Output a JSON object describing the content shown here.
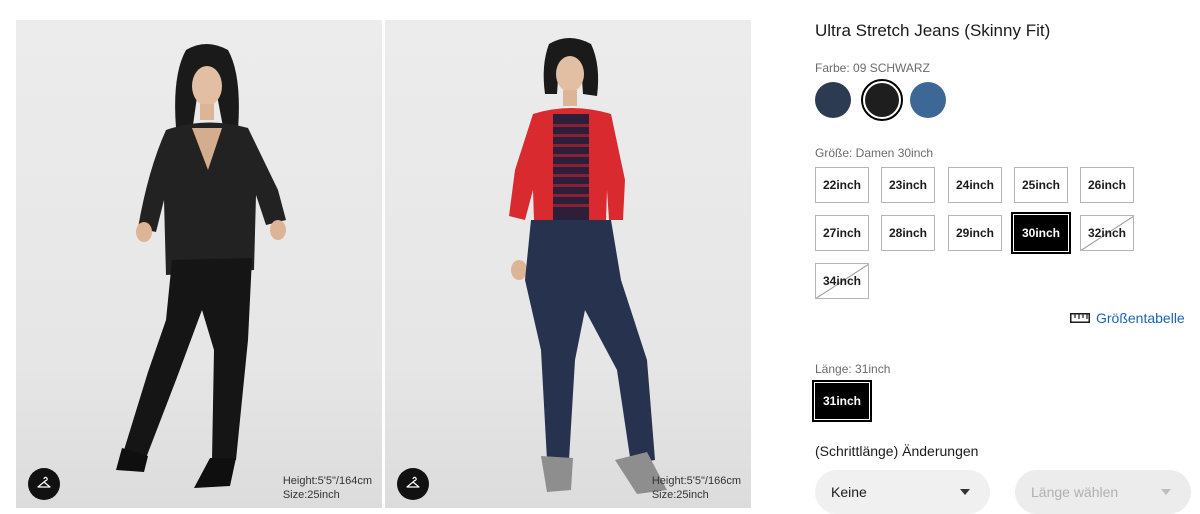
{
  "product": {
    "title": "Ultra Stretch Jeans (Skinny Fit)"
  },
  "color": {
    "label": "Farbe: 09 SCHWARZ",
    "swatches": [
      {
        "name": "navy",
        "hex": "#2c3a52",
        "selected": false
      },
      {
        "name": "black",
        "hex": "#1e1e1e",
        "selected": true
      },
      {
        "name": "blue",
        "hex": "#3d6796",
        "selected": false
      }
    ]
  },
  "size": {
    "label": "Größe: Damen 30inch",
    "options": [
      {
        "label": "22inch",
        "state": "available"
      },
      {
        "label": "23inch",
        "state": "available"
      },
      {
        "label": "24inch",
        "state": "available"
      },
      {
        "label": "25inch",
        "state": "available"
      },
      {
        "label": "26inch",
        "state": "available"
      },
      {
        "label": "27inch",
        "state": "available"
      },
      {
        "label": "28inch",
        "state": "available"
      },
      {
        "label": "29inch",
        "state": "available"
      },
      {
        "label": "30inch",
        "state": "selected"
      },
      {
        "label": "32inch",
        "state": "unavailable"
      },
      {
        "label": "34inch",
        "state": "unavailable"
      }
    ],
    "chart_link": "Größentabelle"
  },
  "length": {
    "label": "Länge: 31inch",
    "options": [
      {
        "label": "31inch",
        "state": "selected"
      }
    ]
  },
  "alterations": {
    "heading": "(Schrittlänge) Änderungen",
    "select_value": "Keine",
    "length_placeholder": "Länge wählen"
  },
  "photos": [
    {
      "model_height": "Height:5'5\"/164cm",
      "model_size": "Size:25inch"
    },
    {
      "model_height": "Height:5'5\"/166cm",
      "model_size": "Size:25inch"
    }
  ],
  "icons": {
    "model_button": "hanger-icon",
    "size_chart": "ruler-icon",
    "dropdown": "chevron-down-icon"
  }
}
